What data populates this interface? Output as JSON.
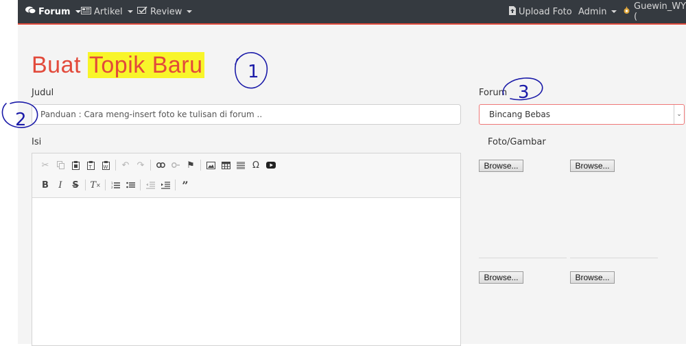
{
  "navbar": {
    "forum": "Forum",
    "artikel": "Artikel",
    "review": "Review",
    "upload_foto": "Upload Foto",
    "admin": "Admin",
    "user": "Guewin_WY ("
  },
  "page": {
    "title_plain": "Buat ",
    "title_highlight": "Topik Baru",
    "judul_label": "Judul",
    "judul_placeholder": "Panduan : Cara meng-insert foto ke tulisan di forum ..",
    "isi_label": "Isi",
    "forum_label": "Forum",
    "forum_selected": "Bincang Bebas",
    "foto_label": "Foto/Gambar",
    "browse_label": "Browse..."
  },
  "annotations": {
    "one": "1",
    "two": "2",
    "three": "3"
  },
  "colors": {
    "accent": "#e24a3b",
    "navbar_bg": "#353a40",
    "highlight": "#f8f52a",
    "annotation_ink": "#1a1aa8"
  }
}
